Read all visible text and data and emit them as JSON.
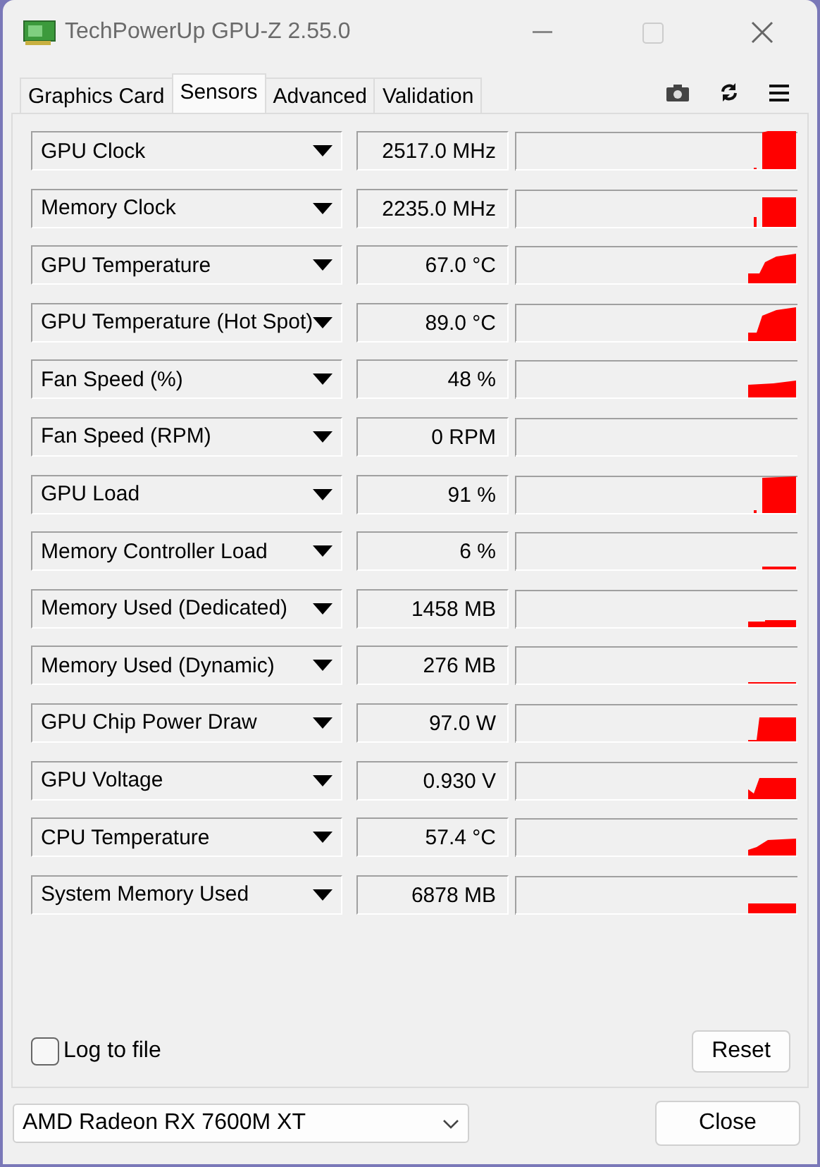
{
  "window": {
    "title": "TechPowerUp GPU-Z 2.55.0"
  },
  "tabs": [
    {
      "label": "Graphics Card",
      "selected": false
    },
    {
      "label": "Sensors",
      "selected": true
    },
    {
      "label": "Advanced",
      "selected": false
    },
    {
      "label": "Validation",
      "selected": false
    }
  ],
  "sensors": [
    {
      "name": "GPU Clock",
      "reading": "2517.0 MHz"
    },
    {
      "name": "Memory Clock",
      "reading": "2235.0 MHz"
    },
    {
      "name": "GPU Temperature",
      "reading": "67.0 °C"
    },
    {
      "name": "GPU Temperature (Hot Spot)",
      "reading": "89.0 °C"
    },
    {
      "name": "Fan Speed (%)",
      "reading": "48 %"
    },
    {
      "name": "Fan Speed (RPM)",
      "reading": "0 RPM"
    },
    {
      "name": "GPU Load",
      "reading": "91 %"
    },
    {
      "name": "Memory Controller Load",
      "reading": "6 %"
    },
    {
      "name": "Memory Used (Dedicated)",
      "reading": "1458 MB"
    },
    {
      "name": "Memory Used (Dynamic)",
      "reading": "276 MB"
    },
    {
      "name": "GPU Chip Power Draw",
      "reading": "97.0 W"
    },
    {
      "name": "GPU Voltage",
      "reading": "0.930 V"
    },
    {
      "name": "CPU Temperature",
      "reading": "57.4 °C"
    },
    {
      "name": "System Memory Used",
      "reading": "6878 MB"
    }
  ],
  "log_to_file": {
    "label": "Log to file",
    "checked": false
  },
  "reset_button": "Reset",
  "device_select": {
    "value": "AMD Radeon RX 7600M XT"
  },
  "close_button": "Close"
}
